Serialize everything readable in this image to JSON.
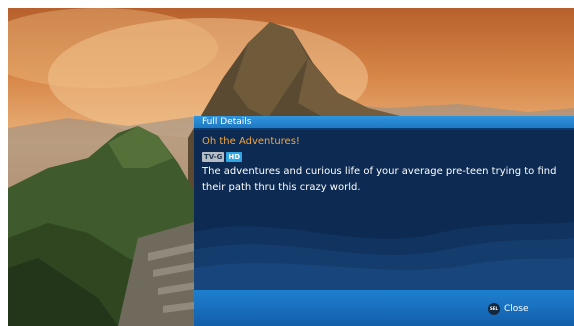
{
  "panel": {
    "header_title": "Full Details",
    "program_title": "Oh the Adventures!",
    "rating_badge": "TV-G",
    "hd_badge": "HD",
    "description": "The adventures and curious life of your average pre-teen trying to find their path thru this crazy world."
  },
  "footer": {
    "sel_icon_label": "SEL",
    "close_label": "Close"
  },
  "colors": {
    "header_blue": "#2f95dc",
    "panel_navy": "#0d2b52",
    "title_orange": "#f0a640",
    "hd_badge_blue": "#2fa6e6"
  },
  "icons": {
    "select_button": "sel-button-icon"
  }
}
